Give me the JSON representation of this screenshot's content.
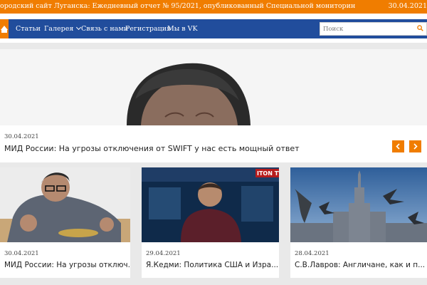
{
  "ticker": {
    "text": "ородский сайт Луганска:  Ежедневный отчет № 95/2021, опубликованный Специальной мониторин",
    "date": "30.04.2021"
  },
  "nav": {
    "items": [
      {
        "label": "Статьи"
      },
      {
        "label": "Галерея"
      },
      {
        "label": "Связь с нами"
      },
      {
        "label": "Регистрация"
      },
      {
        "label": "Мы в VK"
      }
    ],
    "search_placeholder": "Поиск"
  },
  "hero": {
    "date": "30.04.2021",
    "title": "МИД России: На угрозы отключения от SWIFT у нас есть мощный ответ"
  },
  "cards": [
    {
      "date": "30.04.2021",
      "title": "МИД России: На угрозы отключ..."
    },
    {
      "date": "29.04.2021",
      "title": "Я.Кедми: Политика США и Изра..."
    },
    {
      "date": "28.04.2021",
      "title": "С.В.Лавров: Англичане, как и п..."
    }
  ],
  "card2_logo": "ITON TV",
  "colors": {
    "orange": "#f07d00",
    "nav_blue": "#214d9c",
    "background": "#e9e9e9"
  }
}
